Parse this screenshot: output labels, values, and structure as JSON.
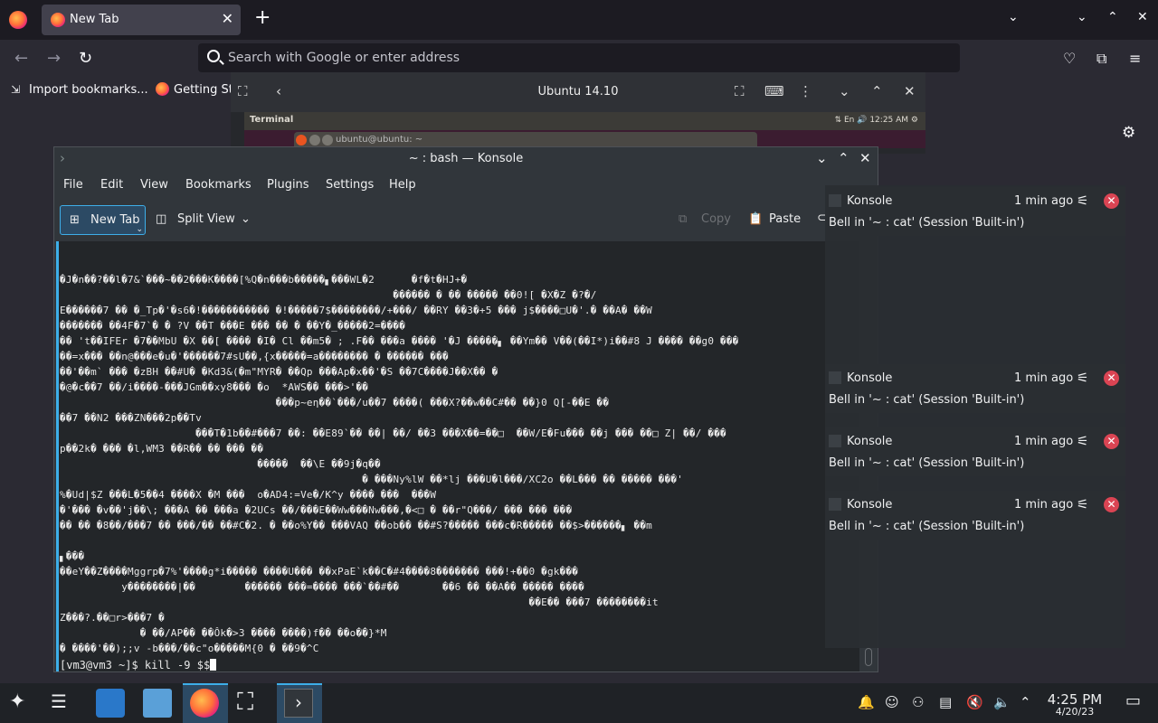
{
  "firefox": {
    "tab_title": "New Tab",
    "tab_close": "✕",
    "new_tab": "+",
    "url_placeholder": "Search with Google or enter address",
    "bookmarks": [
      "Import bookmarks...",
      "Getting St"
    ]
  },
  "vm_window": {
    "title": "Ubuntu 14.10",
    "guest_panel_title": "Terminal",
    "guest_panel_lang": "En",
    "guest_panel_time": "12:25 AM",
    "guest_terminal_title": "ubuntu@ubuntu: ~"
  },
  "konsole": {
    "title": "~ : bash — Konsole",
    "menu": [
      "File",
      "Edit",
      "View",
      "Bookmarks",
      "Plugins",
      "Settings",
      "Help"
    ],
    "toolbar": {
      "new_tab": "New Tab",
      "split_view": "Split View",
      "copy": "Copy",
      "paste": "Paste"
    },
    "garbage_lines": [
      "�J�n��?��l�7&`���~��2���K����[%Q�n���b�����▖���WL�2      �f�t�HJ+�",
      "                                                      ������ � �� ����� ��0![ �X�Z �?�/",
      "E������7 �� �_Tp�'�s6�!����������� �!�����7$��������/+���/ ��RY ��3�+5 ��� j$����□U�'.� ��A� ��W",
      "������� ��4F�7`� � ?V ��T ���E ��� �� � ��Y�_�����2=����",
      "�� 't��IFEr �7��MbU �X ��[ ���� �I� Cl ��m5� ; .F�� ���a ���� '�J �����▖ ��Ym�� V��(��I*)i��#8 J ���� ��g0 ���",
      "��=x��� ��n@���e�u�'������7#sU��,{x�����=a�������� � ������ ���",
      "��'��m` ��� �zBH ��#U� �Kd3&(�m\"MYR� ��Qp ���Ap�x��'�S ��7C����J��X�� �",
      "�@�c��7 ��/i����-���JGm��xy8��� �o  *AWS�� ���>'��",
      "                                   ���p~eη��`���/u��7 ����( ���X?��w��C#�� ��}0 Q[-��E ��",
      "��7 ��N2 ���ZN���2p��Tv",
      "                      ���T�1b��#���7 ��: ��E89`�� ��| ��/ ��3 ���X��=��□  ��W/E�Fu��� ��j ��� ��□ Z| ��/ ���",
      "p��2k� ��� �l,WM3 ��R�� �� ��� ��",
      "                                �����  ��\\E ��9j�q��",
      "                                                 � ���Ny%lW ��*lj ���U�l���/XC2o ��L��� �� ����� ���'",
      "%�Ud|$Z ���L�5��4 ����X �M ���  o�AD4:=Ve�/K^y ���� ���  ���W",
      "�'��� �v��'j��\\; ���A �� ���a �2UCs ��/���E��Ww���Nw���,�<□ � ��r\"Q���/ ��� ��� ���",
      "�� �� �8��/���7 �� ���/�� ��#C�2. � ��o%Y�� ���VAQ ��ob�� ��#S?����� ���c�R����� ��$>������▖ ��m",
      "",
      "▖���",
      "��eY��Z����Mggrp�7%'����g*i����� ����U��� ��xPaE`k��C�#4����8������� ���!+��0 �gk���",
      "          y��������|��        ������ ���=���� ���`��#��       ��6 �� ��A�� ����� ����",
      "                                                                            ��E�� ���7 ��������it",
      "Z���?.��□r>���7 �",
      "             � ��/AP�� ��Ôk�>3 ���� ����)f�� ��o��}*M",
      "� ����'��);;v -b���/��c\"o�����M{0 � ��9�^C"
    ],
    "prompt": "[vm3@vm3 ~]$ kill -9 $$"
  },
  "notifications": [
    {
      "app": "Konsole",
      "time": "1 min ago",
      "body": "Bell in '~ : cat' (Session 'Built-in')"
    },
    {
      "app": "Konsole",
      "time": "1 min ago",
      "body": "Bell in '~ : cat' (Session 'Built-in')"
    },
    {
      "app": "Konsole",
      "time": "1 min ago",
      "body": "Bell in '~ : cat' (Session 'Built-in')"
    },
    {
      "app": "Konsole",
      "time": "1 min ago",
      "body": "Bell in '~ : cat' (Session 'Built-in')"
    }
  ],
  "taskbar": {
    "clock": "4:25 PM",
    "date": "4/20/23"
  },
  "colors": {
    "accent": "#3daee9",
    "close_red": "#da4453",
    "firefox_bg": "#2b2a33"
  }
}
